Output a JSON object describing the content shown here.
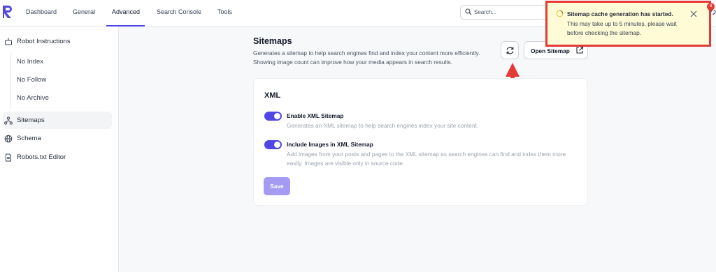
{
  "nav": {
    "tabs": [
      {
        "label": "Dashboard"
      },
      {
        "label": "General"
      },
      {
        "label": "Advanced"
      },
      {
        "label": "Search Console"
      },
      {
        "label": "Tools"
      }
    ],
    "active_tab": "Advanced",
    "search_placeholder": "Search..."
  },
  "sidebar": {
    "robot_instructions": "Robot Instructions",
    "sub_items": [
      "No Index",
      "No Follow",
      "No Archive"
    ],
    "sitemaps": "Sitemaps",
    "schema": "Schema",
    "robots_editor": "Robots.txt Editor"
  },
  "main": {
    "title": "Sitemaps",
    "description": "Generates a sitemap to help search engines find and index your content more efficiently. Showing image count can improve how your media appears in search results.",
    "open_sitemap": "Open Sitemap",
    "card": {
      "title": "XML",
      "options": [
        {
          "label": "Enable XML Sitemap",
          "desc": "Generates an XML sitemap to help search engines index your site content.",
          "enabled": true
        },
        {
          "label": "Include Images in XML Sitemap",
          "desc": "Add images from your posts and pages to the XML sitemap so search engines can find and index them more easily. Images are visible only in source code.",
          "enabled": true
        }
      ],
      "save_label": "Save"
    }
  },
  "toast": {
    "title": "Sitemap cache generation has started.",
    "body": "This may take up to 5 minutes, please wait before checking the sitemap.",
    "badge": "8"
  },
  "colors": {
    "accent": "#4f46e5",
    "save_disabled": "#a59bf2",
    "toast_bg": "#fffbd6",
    "highlight_red": "#e53935"
  }
}
